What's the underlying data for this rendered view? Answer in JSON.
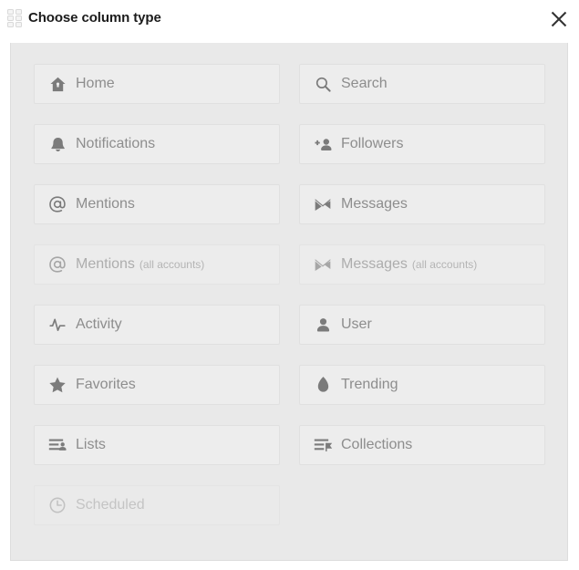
{
  "header": {
    "title": "Choose column type",
    "grid_icon": "columns-grid-icon",
    "close_icon": "close-icon"
  },
  "colors": {
    "panel_bg": "#e9e9e9",
    "button_bg": "#ededed",
    "button_border": "#e0e0e0",
    "label": "#8d8d8d",
    "icon": "#7b7b7b",
    "muted_label": "#adadad",
    "disabled_label": "#c4c4c4",
    "title": "#1b1b1b"
  },
  "columns": [
    {
      "label": "Home",
      "suffix": "",
      "icon": "home-icon",
      "state": "normal"
    },
    {
      "label": "Search",
      "suffix": "",
      "icon": "search-icon",
      "state": "normal"
    },
    {
      "label": "Notifications",
      "suffix": "",
      "icon": "bell-icon",
      "state": "normal"
    },
    {
      "label": "Followers",
      "suffix": "",
      "icon": "add-person-icon",
      "state": "normal"
    },
    {
      "label": "Mentions",
      "suffix": "",
      "icon": "at-sign-icon",
      "state": "normal"
    },
    {
      "label": "Messages",
      "suffix": "",
      "icon": "envelope-icon",
      "state": "normal"
    },
    {
      "label": "Mentions",
      "suffix": "(all accounts)",
      "icon": "at-sign-icon",
      "state": "muted"
    },
    {
      "label": "Messages",
      "suffix": "(all accounts)",
      "icon": "envelope-icon",
      "state": "muted"
    },
    {
      "label": "Activity",
      "suffix": "",
      "icon": "pulse-icon",
      "state": "normal"
    },
    {
      "label": "User",
      "suffix": "",
      "icon": "person-icon",
      "state": "normal"
    },
    {
      "label": "Favorites",
      "suffix": "",
      "icon": "star-icon",
      "state": "normal"
    },
    {
      "label": "Trending",
      "suffix": "",
      "icon": "flame-icon",
      "state": "normal"
    },
    {
      "label": "Lists",
      "suffix": "",
      "icon": "list-person-icon",
      "state": "normal"
    },
    {
      "label": "Collections",
      "suffix": "",
      "icon": "list-pin-icon",
      "state": "normal"
    },
    {
      "label": "Scheduled",
      "suffix": "",
      "icon": "clock-icon",
      "state": "disabled"
    }
  ]
}
